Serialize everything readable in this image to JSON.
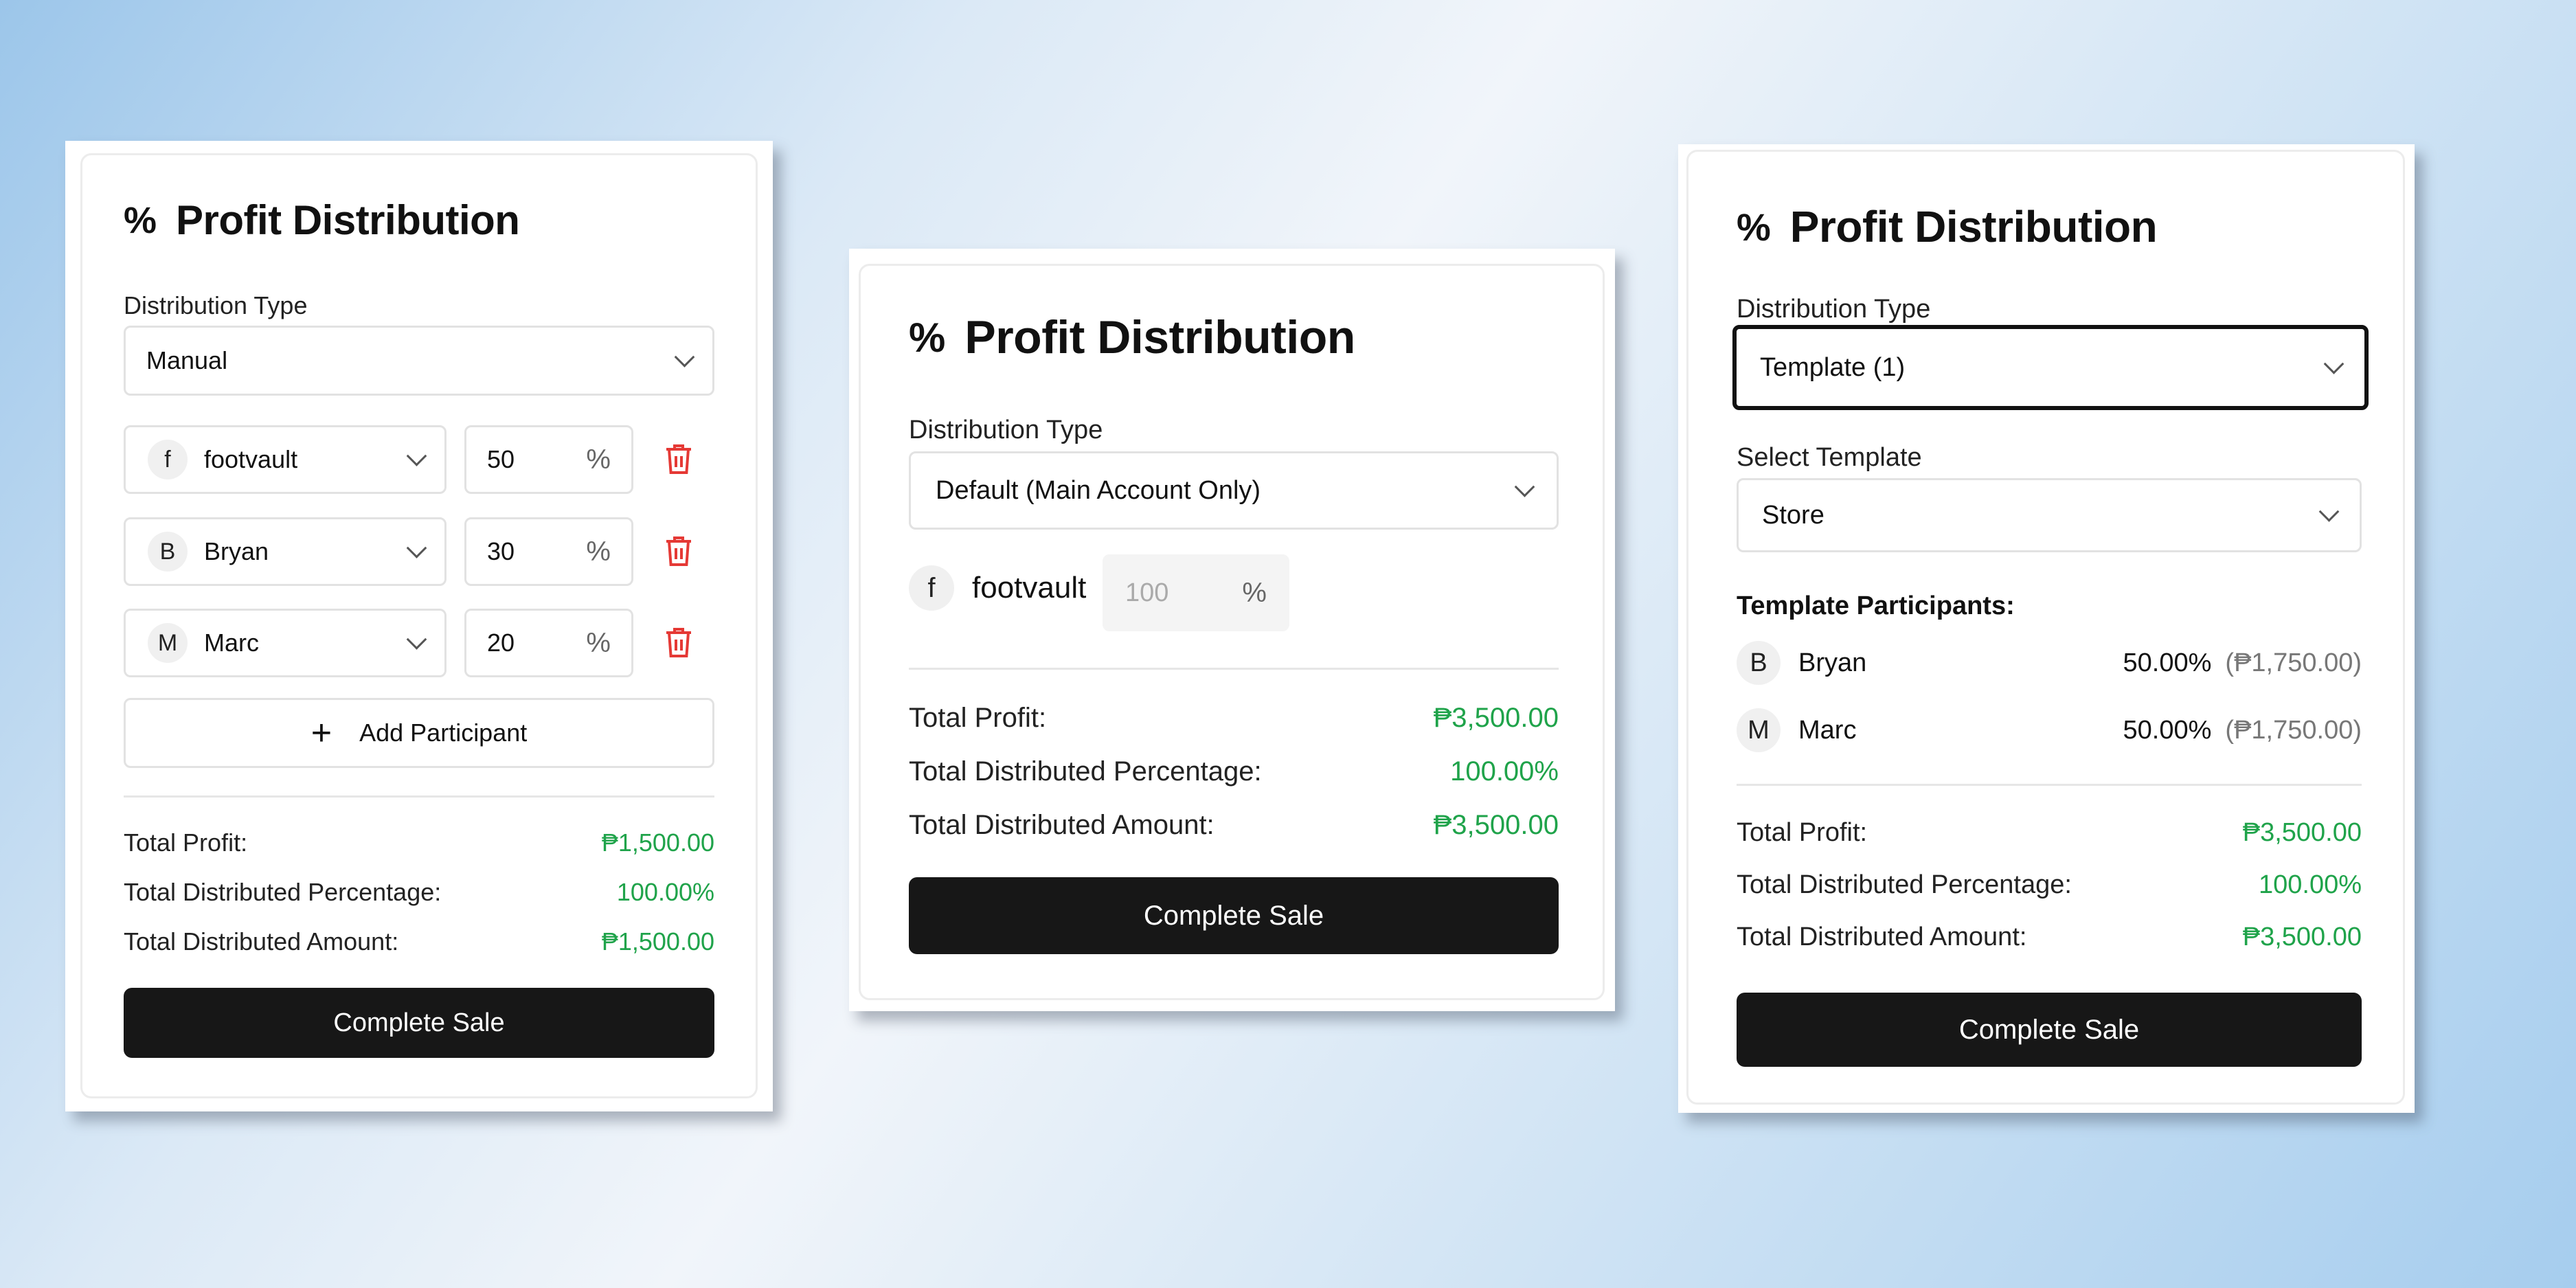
{
  "title": "Profit Distribution",
  "title_icon": "percent-icon",
  "colors": {
    "accent_green": "#1fa34a",
    "button_dark": "#171717",
    "danger_red": "#e53935"
  },
  "panel1": {
    "distribution_type_label": "Distribution Type",
    "distribution_type_value": "Manual",
    "participants": [
      {
        "initial": "f",
        "name": "footvault",
        "percent": "50",
        "unit": "%"
      },
      {
        "initial": "B",
        "name": "Bryan",
        "percent": "30",
        "unit": "%"
      },
      {
        "initial": "M",
        "name": "Marc",
        "percent": "20",
        "unit": "%"
      }
    ],
    "add_participant_label": "Add Participant",
    "summary": {
      "total_profit_label": "Total Profit:",
      "total_profit_value": "₱1,500.00",
      "pct_label": "Total Distributed Percentage:",
      "pct_value": "100.00%",
      "amount_label": "Total Distributed Amount:",
      "amount_value": "₱1,500.00"
    },
    "complete_label": "Complete Sale"
  },
  "panel2": {
    "distribution_type_label": "Distribution Type",
    "distribution_type_value": "Default (Main Account Only)",
    "participant": {
      "initial": "f",
      "name": "footvault",
      "percent_placeholder": "100",
      "unit": "%"
    },
    "summary": {
      "total_profit_label": "Total Profit:",
      "total_profit_value": "₱3,500.00",
      "pct_label": "Total Distributed Percentage:",
      "pct_value": "100.00%",
      "amount_label": "Total Distributed Amount:",
      "amount_value": "₱3,500.00"
    },
    "complete_label": "Complete Sale"
  },
  "panel3": {
    "distribution_type_label": "Distribution Type",
    "distribution_type_value": "Template (1)",
    "select_template_label": "Select Template",
    "select_template_value": "Store",
    "participants_heading": "Template Participants:",
    "participants": [
      {
        "initial": "B",
        "name": "Bryan",
        "percent": "50.00%",
        "amount": "(₱1,750.00)"
      },
      {
        "initial": "M",
        "name": "Marc",
        "percent": "50.00%",
        "amount": "(₱1,750.00)"
      }
    ],
    "summary": {
      "total_profit_label": "Total Profit:",
      "total_profit_value": "₱3,500.00",
      "pct_label": "Total Distributed Percentage:",
      "pct_value": "100.00%",
      "amount_label": "Total Distributed Amount:",
      "amount_value": "₱3,500.00"
    },
    "complete_label": "Complete Sale"
  }
}
